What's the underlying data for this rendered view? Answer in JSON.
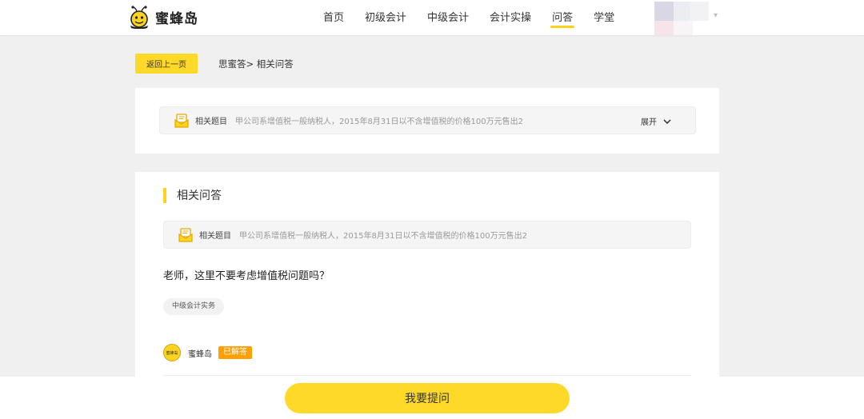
{
  "brand": {
    "name": "蜜蜂岛"
  },
  "nav": {
    "items": [
      {
        "label": "首页"
      },
      {
        "label": "初级会计"
      },
      {
        "label": "中级会计"
      },
      {
        "label": "会计实操"
      },
      {
        "label": "问答"
      },
      {
        "label": "学堂"
      }
    ],
    "active": "问答"
  },
  "user": {
    "caret": "▾"
  },
  "breadcrumb": {
    "back_label": "返回上一页",
    "path": "思蜜答> 相关问答"
  },
  "topic_card": {
    "label": "相关题目",
    "text": "甲公司系增值税一般纳税人，2015年8月31日以不含增值税的价格100万元售出2",
    "expand_label": "展开"
  },
  "qa": {
    "section_title": "相关问答",
    "topic_label": "相关题目",
    "topic_text": "甲公司系增值税一般纳税人，2015年8月31日以不含增值税的价格100万元售出2",
    "question": "老师，这里不要考虑增值税问题吗？",
    "tag": "中级会计实务",
    "answerer": {
      "avatar_text": "蜜蜂岛",
      "name": "蜜蜂岛",
      "status": "已解答"
    }
  },
  "footer": {
    "ask_label": "我要提问"
  },
  "colors": {
    "accent": "#ffd928",
    "answered_badge": "#ff9f00"
  }
}
